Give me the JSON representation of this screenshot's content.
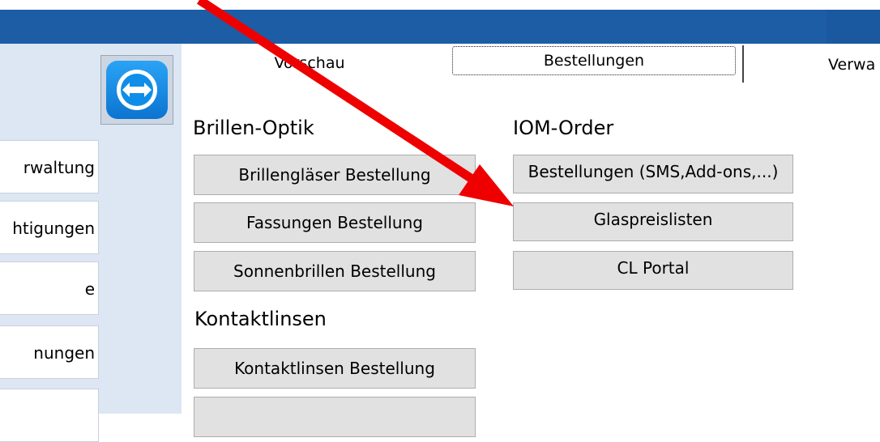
{
  "tabs": [
    {
      "label": "Vorschau"
    },
    {
      "label": "Bestellungen"
    },
    {
      "label": "Verwa"
    }
  ],
  "sidebar": {
    "items": [
      {
        "label": "rwaltung"
      },
      {
        "label": "htigungen"
      },
      {
        "label": "e"
      },
      {
        "label": "nungen"
      },
      {
        "label": ""
      }
    ]
  },
  "brillen_optik": {
    "title": "Brillen-Optik",
    "buttons": [
      {
        "label": "Brillengläser Bestellung"
      },
      {
        "label": "Fassungen Bestellung"
      },
      {
        "label": "Sonnenbrillen Bestellung"
      }
    ]
  },
  "kontaktlinsen": {
    "title": "Kontaktlinsen",
    "buttons": [
      {
        "label": "Kontaktlinsen Bestellung"
      },
      {
        "label": ""
      }
    ]
  },
  "iom_order": {
    "title": "IOM-Order",
    "buttons": [
      {
        "label": "Bestellungen (SMS,Add-ons,...)"
      },
      {
        "label": "Glaspreislisten"
      },
      {
        "label": "CL Portal"
      }
    ]
  },
  "icons": {
    "logo": "teamviewer-icon",
    "annotation": "red-arrow-icon"
  },
  "colors": {
    "titlebar": "#1c5da6",
    "sidebar_bg": "#dde7f3",
    "button_bg": "#e1e1e1",
    "arrow": "#ee0000",
    "logo_blue": "#0e8ee9"
  }
}
